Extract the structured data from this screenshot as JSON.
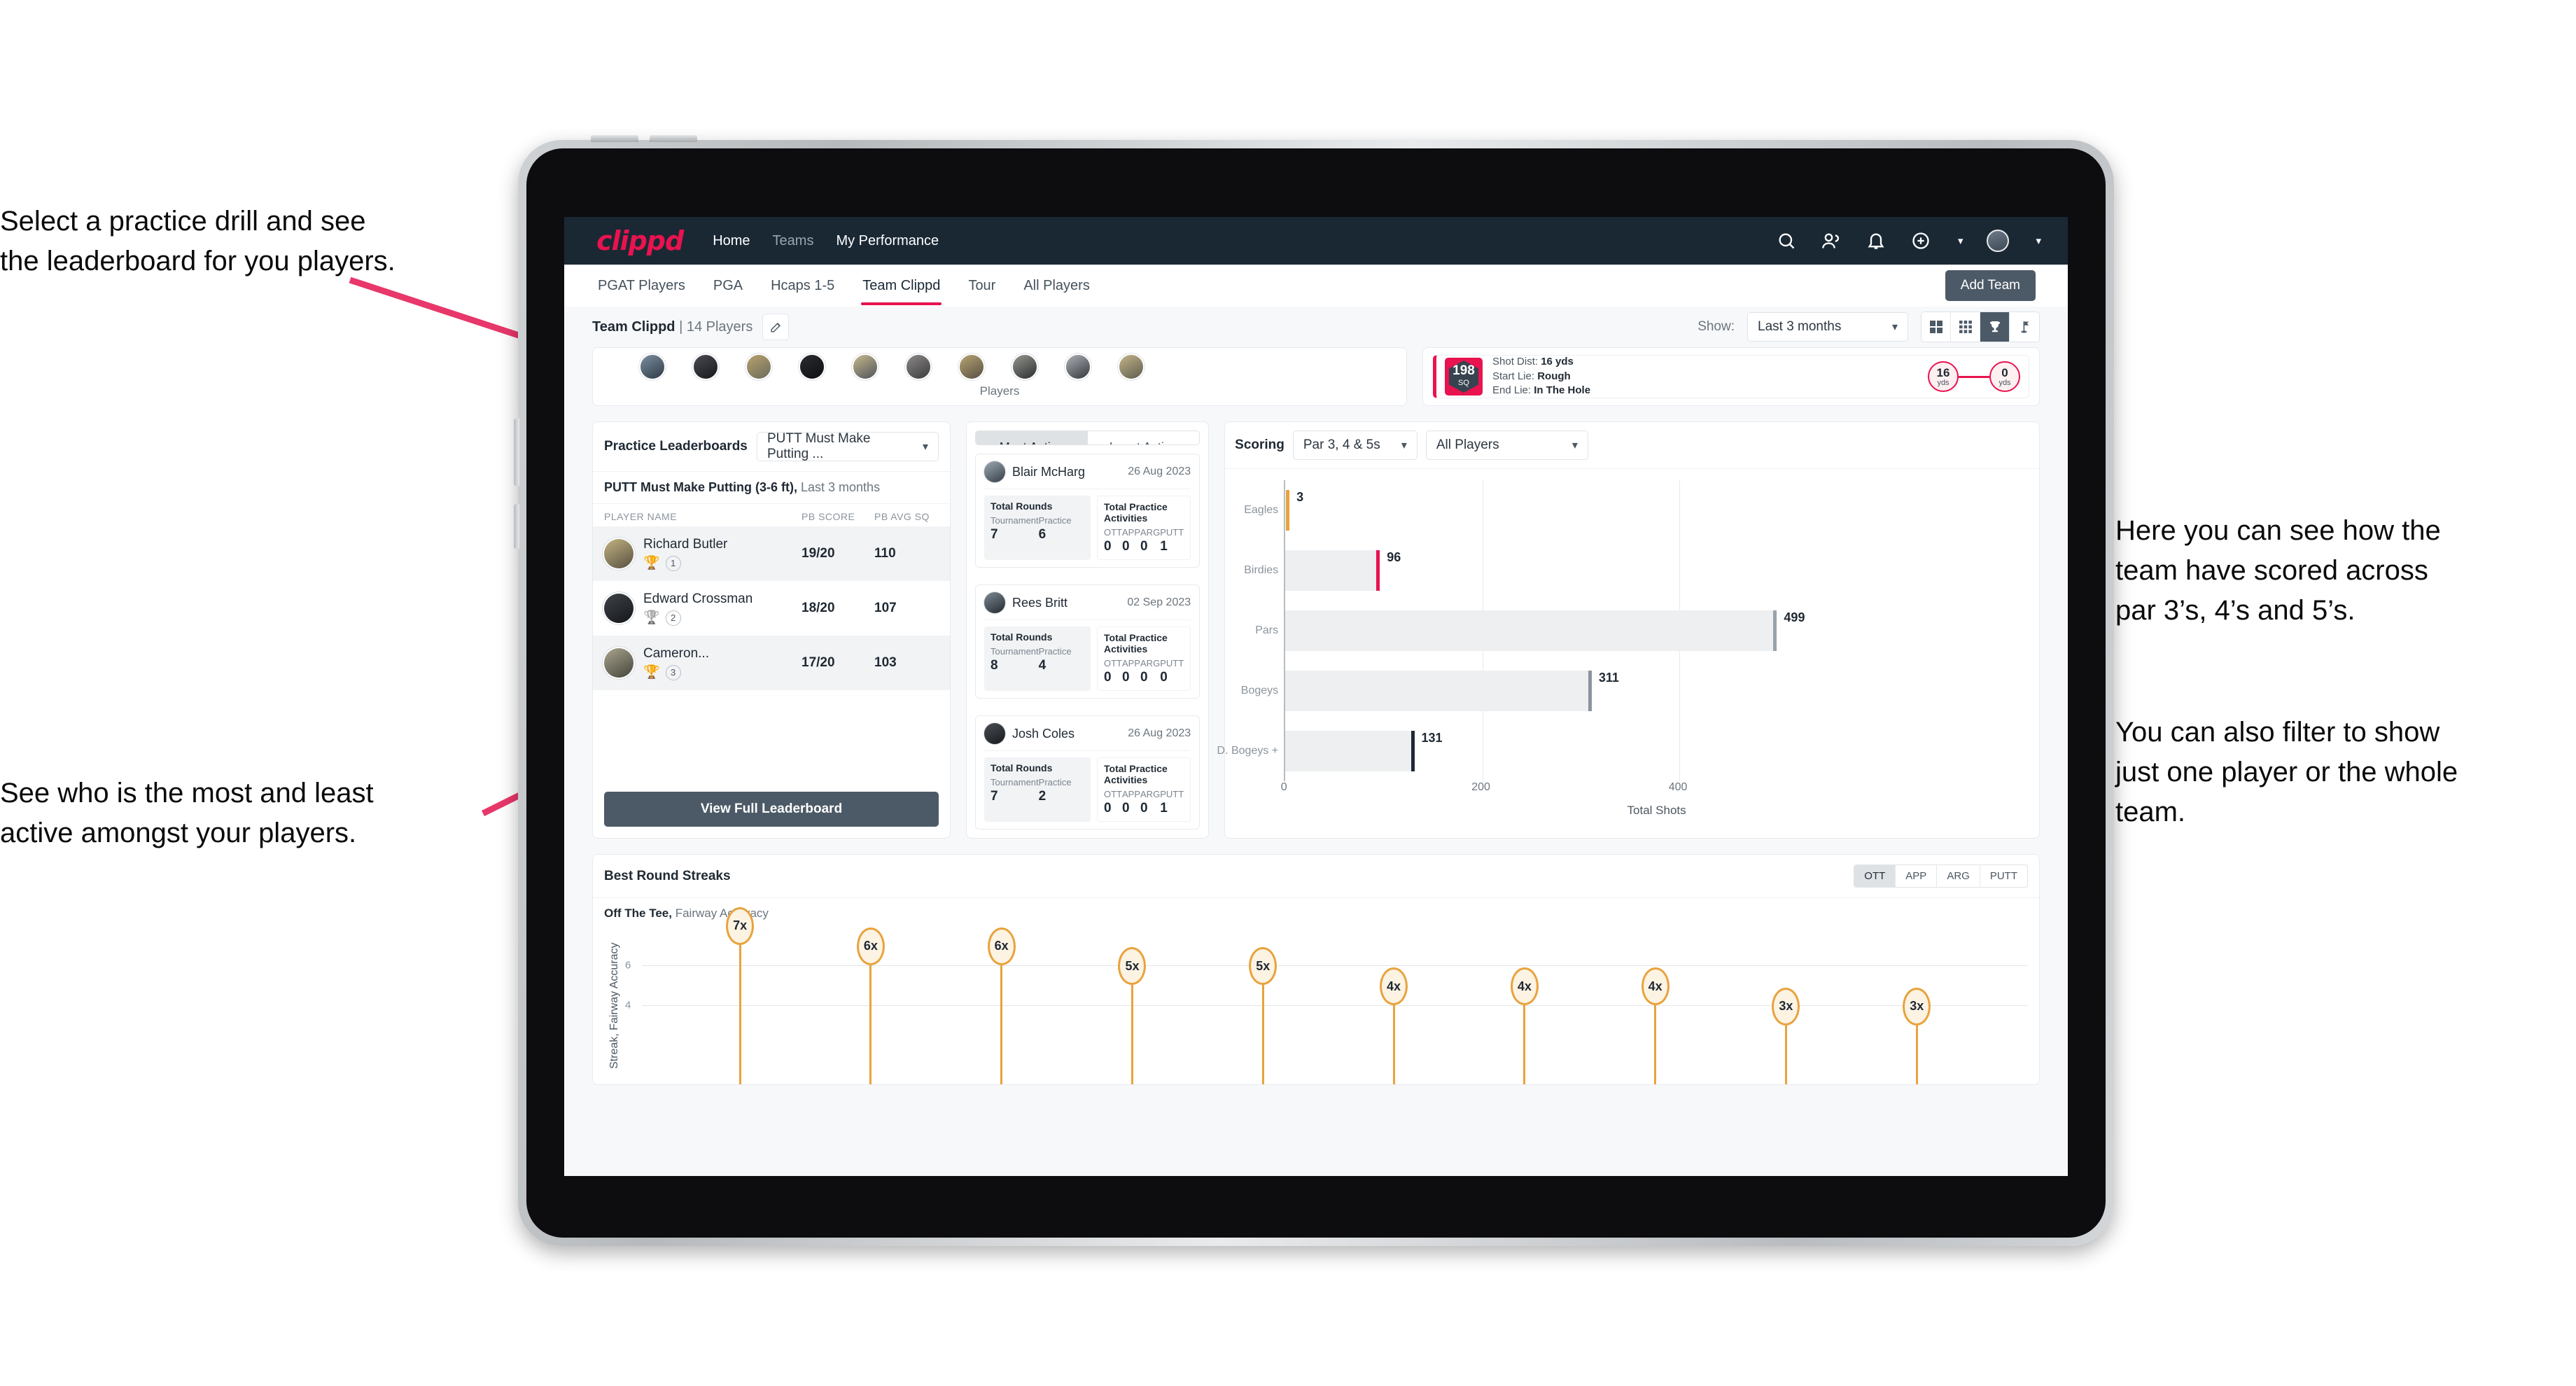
{
  "annotations": {
    "left_top": "Select a practice drill and see\nthe leaderboard for you players.",
    "left_bottom": "See who is the most and least\nactive amongst your players.",
    "right_1": "Here you can see how the\nteam have scored across\npar 3’s, 4’s and 5’s.",
    "right_2": "You can also filter to show\njust one player or the whole\nteam."
  },
  "nav": {
    "logo": "clippd",
    "links": [
      {
        "label": "Home",
        "active": true
      },
      {
        "label": "Teams",
        "active": false
      },
      {
        "label": "My Performance",
        "active": true
      }
    ],
    "icons": [
      "search-icon",
      "people-icon",
      "bell-icon",
      "plus-circle-icon",
      "avatar"
    ]
  },
  "tabs": {
    "items": [
      "PGAT Players",
      "PGA",
      "Hcaps 1-5",
      "Team Clippd",
      "Tour",
      "All Players"
    ],
    "active": "Team Clippd",
    "add_team_label": "Add Team"
  },
  "subbar": {
    "team_name": "Team Clippd",
    "team_meta": " | 14 Players",
    "edit_icon": "pencil-icon",
    "show_label": "Show:",
    "range_value": "Last 3 months",
    "view_toggles": [
      {
        "icon": "grid-4-icon",
        "active": false
      },
      {
        "icon": "grid-9-icon",
        "active": false
      },
      {
        "icon": "trophy-icon",
        "active": true
      },
      {
        "icon": "flag-icon",
        "active": false
      }
    ]
  },
  "players_card": {
    "caption": "Players",
    "avatar_count": 10
  },
  "shot_card": {
    "sq_value": "198",
    "sq_unit": "SQ",
    "lines": [
      {
        "label": "Shot Dist:",
        "value": "16 yds"
      },
      {
        "label": "Start Lie:",
        "value": "Rough"
      },
      {
        "label": "End Lie:",
        "value": "In The Hole"
      }
    ],
    "start_dist": {
      "value": "16",
      "unit": "yds"
    },
    "end_dist": {
      "value": "0",
      "unit": "yds"
    }
  },
  "practice_leaderboards": {
    "title": "Practice Leaderboards",
    "drill_select": "PUTT Must Make Putting ...",
    "subtitle_bold": "PUTT Must Make Putting (3-6 ft),",
    "subtitle_dim": " Last 3 months",
    "columns": [
      "PLAYER NAME",
      "PB SCORE",
      "PB AVG SQ"
    ],
    "rows": [
      {
        "name": "Richard Butler",
        "trophy": "gold",
        "rank": "1",
        "pb_score": "19/20",
        "pb_avg_sq": "110"
      },
      {
        "name": "Edward Crossman",
        "trophy": "silver",
        "rank": "2",
        "pb_score": "18/20",
        "pb_avg_sq": "107"
      },
      {
        "name": "Cameron...",
        "trophy": "bronze",
        "rank": "3",
        "pb_score": "17/20",
        "pb_avg_sq": "103"
      }
    ],
    "button_label": "View Full Leaderboard"
  },
  "activity": {
    "tabs": [
      {
        "label": "Most Active",
        "active": true
      },
      {
        "label": "Least Active",
        "active": false
      }
    ],
    "rounds_heading": "Total Rounds",
    "rounds_keys": [
      "Tournament",
      "Practice"
    ],
    "practice_heading": "Total Practice Activities",
    "practice_keys": [
      "OTT",
      "APP",
      "ARG",
      "PUTT"
    ],
    "cards": [
      {
        "name": "Blair McHarg",
        "date": "26 Aug 2023",
        "rounds": [
          "7",
          "6"
        ],
        "practice": [
          "0",
          "0",
          "0",
          "1"
        ]
      },
      {
        "name": "Rees Britt",
        "date": "02 Sep 2023",
        "rounds": [
          "8",
          "4"
        ],
        "practice": [
          "0",
          "0",
          "0",
          "0"
        ]
      },
      {
        "name": "Josh Coles",
        "date": "26 Aug 2023",
        "rounds": [
          "7",
          "2"
        ],
        "practice": [
          "0",
          "0",
          "0",
          "1"
        ]
      }
    ]
  },
  "scoring": {
    "title": "Scoring",
    "par_select": "Par 3, 4 & 5s",
    "player_select": "All Players"
  },
  "streaks": {
    "title": "Best Round Streaks",
    "segments": [
      {
        "label": "OTT",
        "active": true
      },
      {
        "label": "APP",
        "active": false
      },
      {
        "label": "ARG",
        "active": false
      },
      {
        "label": "PUTT",
        "active": false
      }
    ],
    "subtitle_bold": "Off The Tee,",
    "subtitle_dim": " Fairway Accuracy"
  },
  "chart_data": [
    {
      "type": "bar",
      "orientation": "horizontal",
      "title": "Scoring",
      "categories": [
        "Eagles",
        "Birdies",
        "Pars",
        "Bogeys",
        "D. Bogeys +"
      ],
      "values": [
        3,
        96,
        499,
        311,
        131
      ],
      "tip_colors": [
        "#e8a33d",
        "#e8134f",
        "#9aa2a9",
        "#8b949d",
        "#1f2933"
      ],
      "xlabel": "Total Shots",
      "ylabel": "",
      "xlim": [
        0,
        540
      ],
      "xticks": [
        0,
        200,
        400
      ],
      "grid": true,
      "legend": "none"
    },
    {
      "type": "bar",
      "orientation": "vertical-lollipop",
      "title": "Best Round Streaks",
      "subtitle": "Off The Tee, Fairway Accuracy",
      "ylabel": "Streak, Fairway Accuracy",
      "categories": [
        "",
        "",
        "",
        "",
        "",
        "",
        "",
        "",
        "",
        ""
      ],
      "labels": [
        "7x",
        "6x",
        "6x",
        "5x",
        "5x",
        "4x",
        "4x",
        "4x",
        "3x",
        "3x"
      ],
      "values": [
        7,
        6,
        6,
        5,
        5,
        4,
        4,
        4,
        3,
        3
      ],
      "yticks": [
        4,
        6
      ],
      "ylim": [
        0,
        8
      ],
      "grid": true,
      "legend": "none"
    }
  ]
}
